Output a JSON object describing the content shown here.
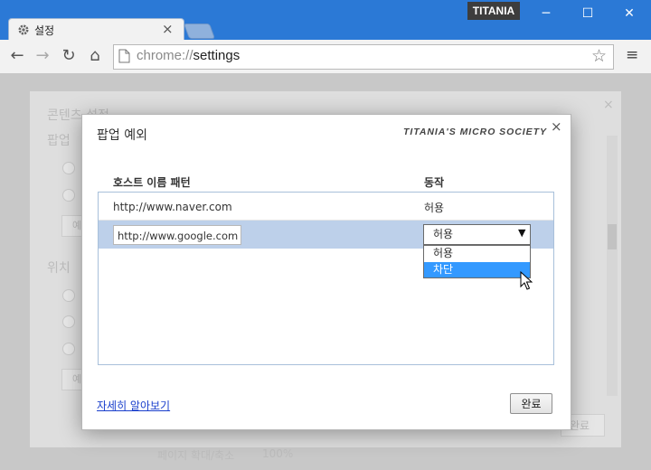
{
  "window": {
    "badge": "TITANIA",
    "minimize_glyph": "─",
    "maximize_glyph": "☐",
    "close_glyph": "✕"
  },
  "tab": {
    "title": "설정",
    "icon": "gear-icon",
    "close_glyph": "×"
  },
  "toolbar": {
    "url_scheme": "chrome://",
    "url_path": "settings",
    "back_glyph": "←",
    "forward_glyph": "→",
    "reload_glyph": "↻",
    "home_glyph": "⌂",
    "star_glyph": "☆",
    "menu_glyph": "≡"
  },
  "background_page": {
    "heading": "콘텐츠 설정",
    "section1": "팝업",
    "section2": "위치",
    "exceptions_button": "예",
    "done_button": "완료",
    "zoom_label": "페이지 확대/축소",
    "zoom_value": "100%"
  },
  "dialog": {
    "title": "팝업 예외",
    "watermark": "TITANIA'S MICRO SOCIETY",
    "close_glyph": "×",
    "col_host": "호스트 이름 패턴",
    "col_action": "동작",
    "rows": [
      {
        "host": "http://www.naver.com",
        "action": "허용"
      }
    ],
    "edit_row": {
      "host": "http://www.google.com",
      "action": "허용",
      "options": [
        "허용",
        "차단"
      ],
      "highlighted": "차단"
    },
    "learn_more": "자세히 알아보기",
    "done_button": "완료"
  },
  "colors": {
    "titlebar": "#2b79d6",
    "selected_row": "#bdd0ea",
    "dropdown_highlight": "#3399ff",
    "link": "#1a3fcc"
  }
}
